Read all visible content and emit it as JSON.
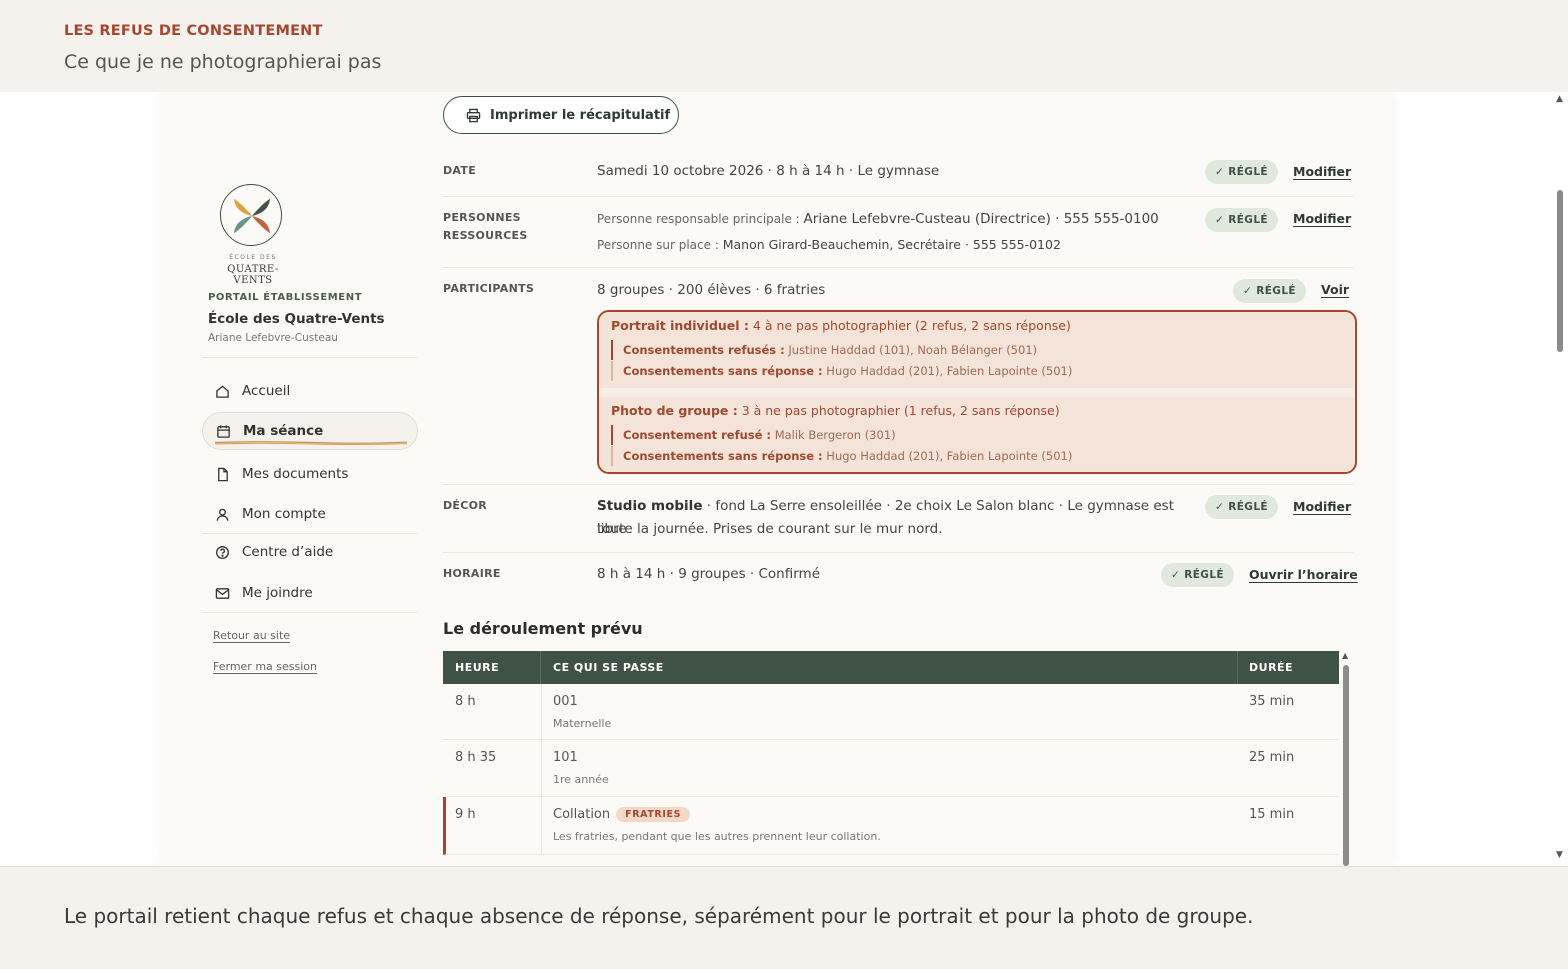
{
  "header": {
    "eyebrow": "LES REFUS DE CONSENTEMENT",
    "subtitle": "Ce que je ne photographierai pas"
  },
  "sidebar": {
    "logo_sub": "ÉCOLE DES",
    "logo_name": "QUATRE-VENTS",
    "portal_label": "PORTAIL ÉTABLISSEMENT",
    "school_name": "École des Quatre-Vents",
    "user_name": "Ariane Lefebvre-Custeau",
    "nav": [
      {
        "label": "Accueil",
        "icon": "home-icon"
      },
      {
        "label": "Ma séance",
        "icon": "calendar-icon",
        "active": true
      },
      {
        "label": "Mes documents",
        "icon": "document-icon"
      },
      {
        "label": "Mon compte",
        "icon": "user-icon"
      },
      {
        "label": "Centre d’aide",
        "icon": "help-icon"
      },
      {
        "label": "Me joindre",
        "icon": "mail-icon"
      }
    ],
    "back_link": "Retour au site",
    "logout_link": "Fermer ma session"
  },
  "main": {
    "print_button": "Imprimer le récapitulatif",
    "badge_ok": "✓ RÉGLÉ",
    "rows": {
      "date": {
        "label": "DATE",
        "text": "Samedi 10 octobre 2026 · 8 h à 14 h · Le gymnase",
        "action": "Modifier"
      },
      "people": {
        "label": "PERSONNES RESSOURCES",
        "line1_prefix": "Personne responsable principale : ",
        "line1_value": "Ariane Lefebvre-Custeau (Directrice) · 555 555-0100",
        "line2_prefix": "Personne sur place : ",
        "line2_value": "Manon Girard-Beauchemin, Secrétaire · 555 555-0102",
        "action": "Modifier"
      },
      "participants": {
        "label": "PARTICIPANTS",
        "text": "8 groupes · 200 élèves · 6 fratries",
        "action": "Voir"
      },
      "decor": {
        "label": "DÉCOR",
        "strong": "Studio mobile",
        "text": " · fond La Serre ensoleillée · 2e choix Le Salon blanc · Le gymnase est libre",
        "text2": "toute la journée. Prises de courant sur le mur nord.",
        "action": "Modifier"
      },
      "schedule": {
        "label": "HORAIRE",
        "text": "8 h à 14 h · 9 groupes · Confirmé",
        "action": "Ouvrir l’horaire"
      }
    },
    "refusals": {
      "portrait": {
        "title": "Portrait individuel :",
        "summary": " 4 à ne pas photographier (2 refus, 2 sans réponse)",
        "refused_label": "Consentements refusés :",
        "refused_names": " Justine Haddad (101), Noah Bélanger (501)",
        "noreply_label": "Consentements sans réponse :",
        "noreply_names": " Hugo Haddad (201), Fabien Lapointe (501)"
      },
      "group": {
        "title": "Photo de groupe :",
        "summary": " 3 à ne pas photographier (1 refus, 2 sans réponse)",
        "refused_label": "Consentement refusé :",
        "refused_names": " Malik Bergeron (301)",
        "noreply_label": "Consentements sans réponse :",
        "noreply_names": " Hugo Haddad (201), Fabien Lapointe (501)"
      }
    },
    "timeline": {
      "title": "Le déroulement prévu",
      "columns": [
        "HEURE",
        "CE QUI SE PASSE",
        "DURÉE"
      ],
      "rows": [
        {
          "time": "8 h",
          "what": "001",
          "sub": "Maternelle",
          "duration": "35 min"
        },
        {
          "time": "8 h 35",
          "what": "101",
          "sub": "1re année",
          "duration": "25 min"
        },
        {
          "time": "9 h",
          "what": "Collation",
          "badge": "FRATRIES",
          "sub": "Les fratries, pendant que les autres prennent leur collation.",
          "duration": "15 min"
        }
      ]
    }
  },
  "footer": {
    "caption": "Le portail retient chaque refus et chaque absence de réponse, séparément pour le portrait et pour la photo de groupe."
  },
  "colors": {
    "accent_rust": "#a5472e",
    "forest_green": "#3f5245",
    "badge_green_bg": "#e1e8dd",
    "refusal_bg": "#f3e3d8"
  }
}
